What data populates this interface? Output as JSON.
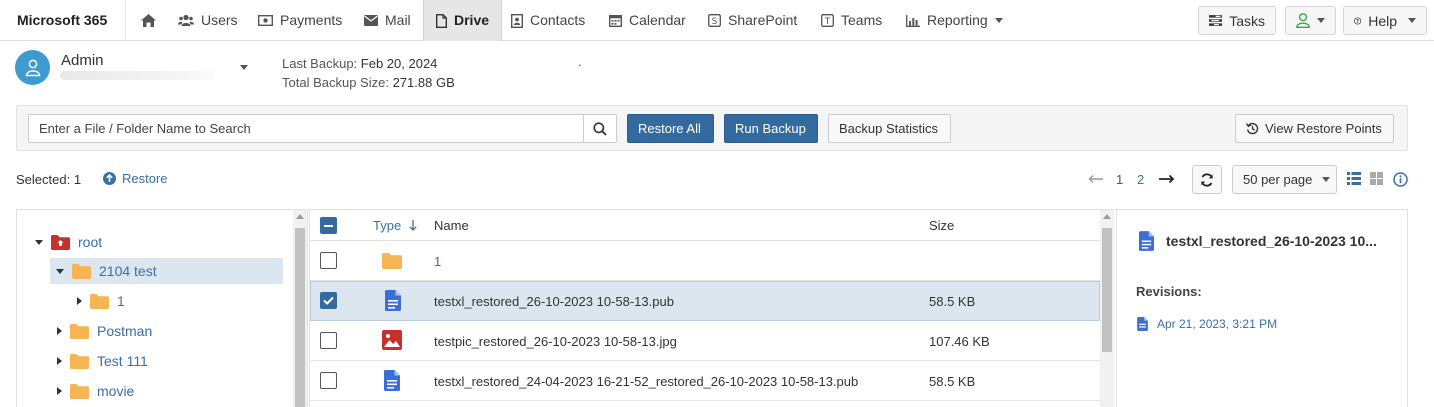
{
  "app": {
    "title": "Microsoft 365"
  },
  "nav": {
    "users": "Users",
    "payments": "Payments",
    "mail": "Mail",
    "drive": "Drive",
    "contacts": "Contacts",
    "calendar": "Calendar",
    "sharepoint": "SharePoint",
    "teams": "Teams",
    "reporting": "Reporting",
    "tasks": "Tasks",
    "help": "Help"
  },
  "account": {
    "name": "Admin",
    "last_backup_label": "Last Backup:",
    "last_backup_value": "Feb 20, 2024",
    "total_size_label": "Total Backup Size:",
    "total_size_value": "271.88 GB",
    "trailing_dot": "."
  },
  "toolbar": {
    "search_placeholder": "Enter a File / Folder Name to Search",
    "restore_all": "Restore All",
    "run_backup": "Run Backup",
    "backup_statistics": "Backup Statistics",
    "view_restore_points": "View Restore Points"
  },
  "selection": {
    "label": "Selected: 1",
    "restore": "Restore"
  },
  "pagination": {
    "pages": [
      "1",
      "2"
    ],
    "current": "1",
    "per_page": "50 per page"
  },
  "tree": [
    {
      "label": "root",
      "expanded": true
    },
    {
      "label": "2104 test",
      "expanded": true,
      "selected": true
    },
    {
      "label": "1",
      "expanded": false
    },
    {
      "label": "Postman",
      "expanded": false
    },
    {
      "label": "Test 111",
      "expanded": false
    },
    {
      "label": "movie",
      "expanded": false
    }
  ],
  "table": {
    "headers": {
      "type": "Type",
      "name": "Name",
      "size": "Size"
    },
    "rows": [
      {
        "type": "folder",
        "name": "1",
        "size": "",
        "checked": false
      },
      {
        "type": "pub",
        "name": "testxl_restored_26-10-2023 10-58-13.pub",
        "size": "58.5 KB",
        "checked": true
      },
      {
        "type": "jpg",
        "name": "testpic_restored_26-10-2023 10-58-13.jpg",
        "size": "107.46 KB",
        "checked": false
      },
      {
        "type": "pub",
        "name": "testxl_restored_24-04-2023 16-21-52_restored_26-10-2023 10-58-13.pub",
        "size": "58.5 KB",
        "checked": false
      }
    ]
  },
  "details": {
    "file_name": "testxl_restored_26-10-2023 10...",
    "revisions_label": "Revisions:",
    "revisions": [
      "Apr 21, 2023, 3:21 PM"
    ]
  },
  "colors": {
    "primary": "#336ba0",
    "link": "#3a6ea5",
    "folder": "#f6b455",
    "selected_row": "#dbe6ef",
    "avatar": "#3d9bd0",
    "root_folder": "#c9302c",
    "file_blue": "#3c6fd4",
    "image_red": "#c9302c"
  }
}
